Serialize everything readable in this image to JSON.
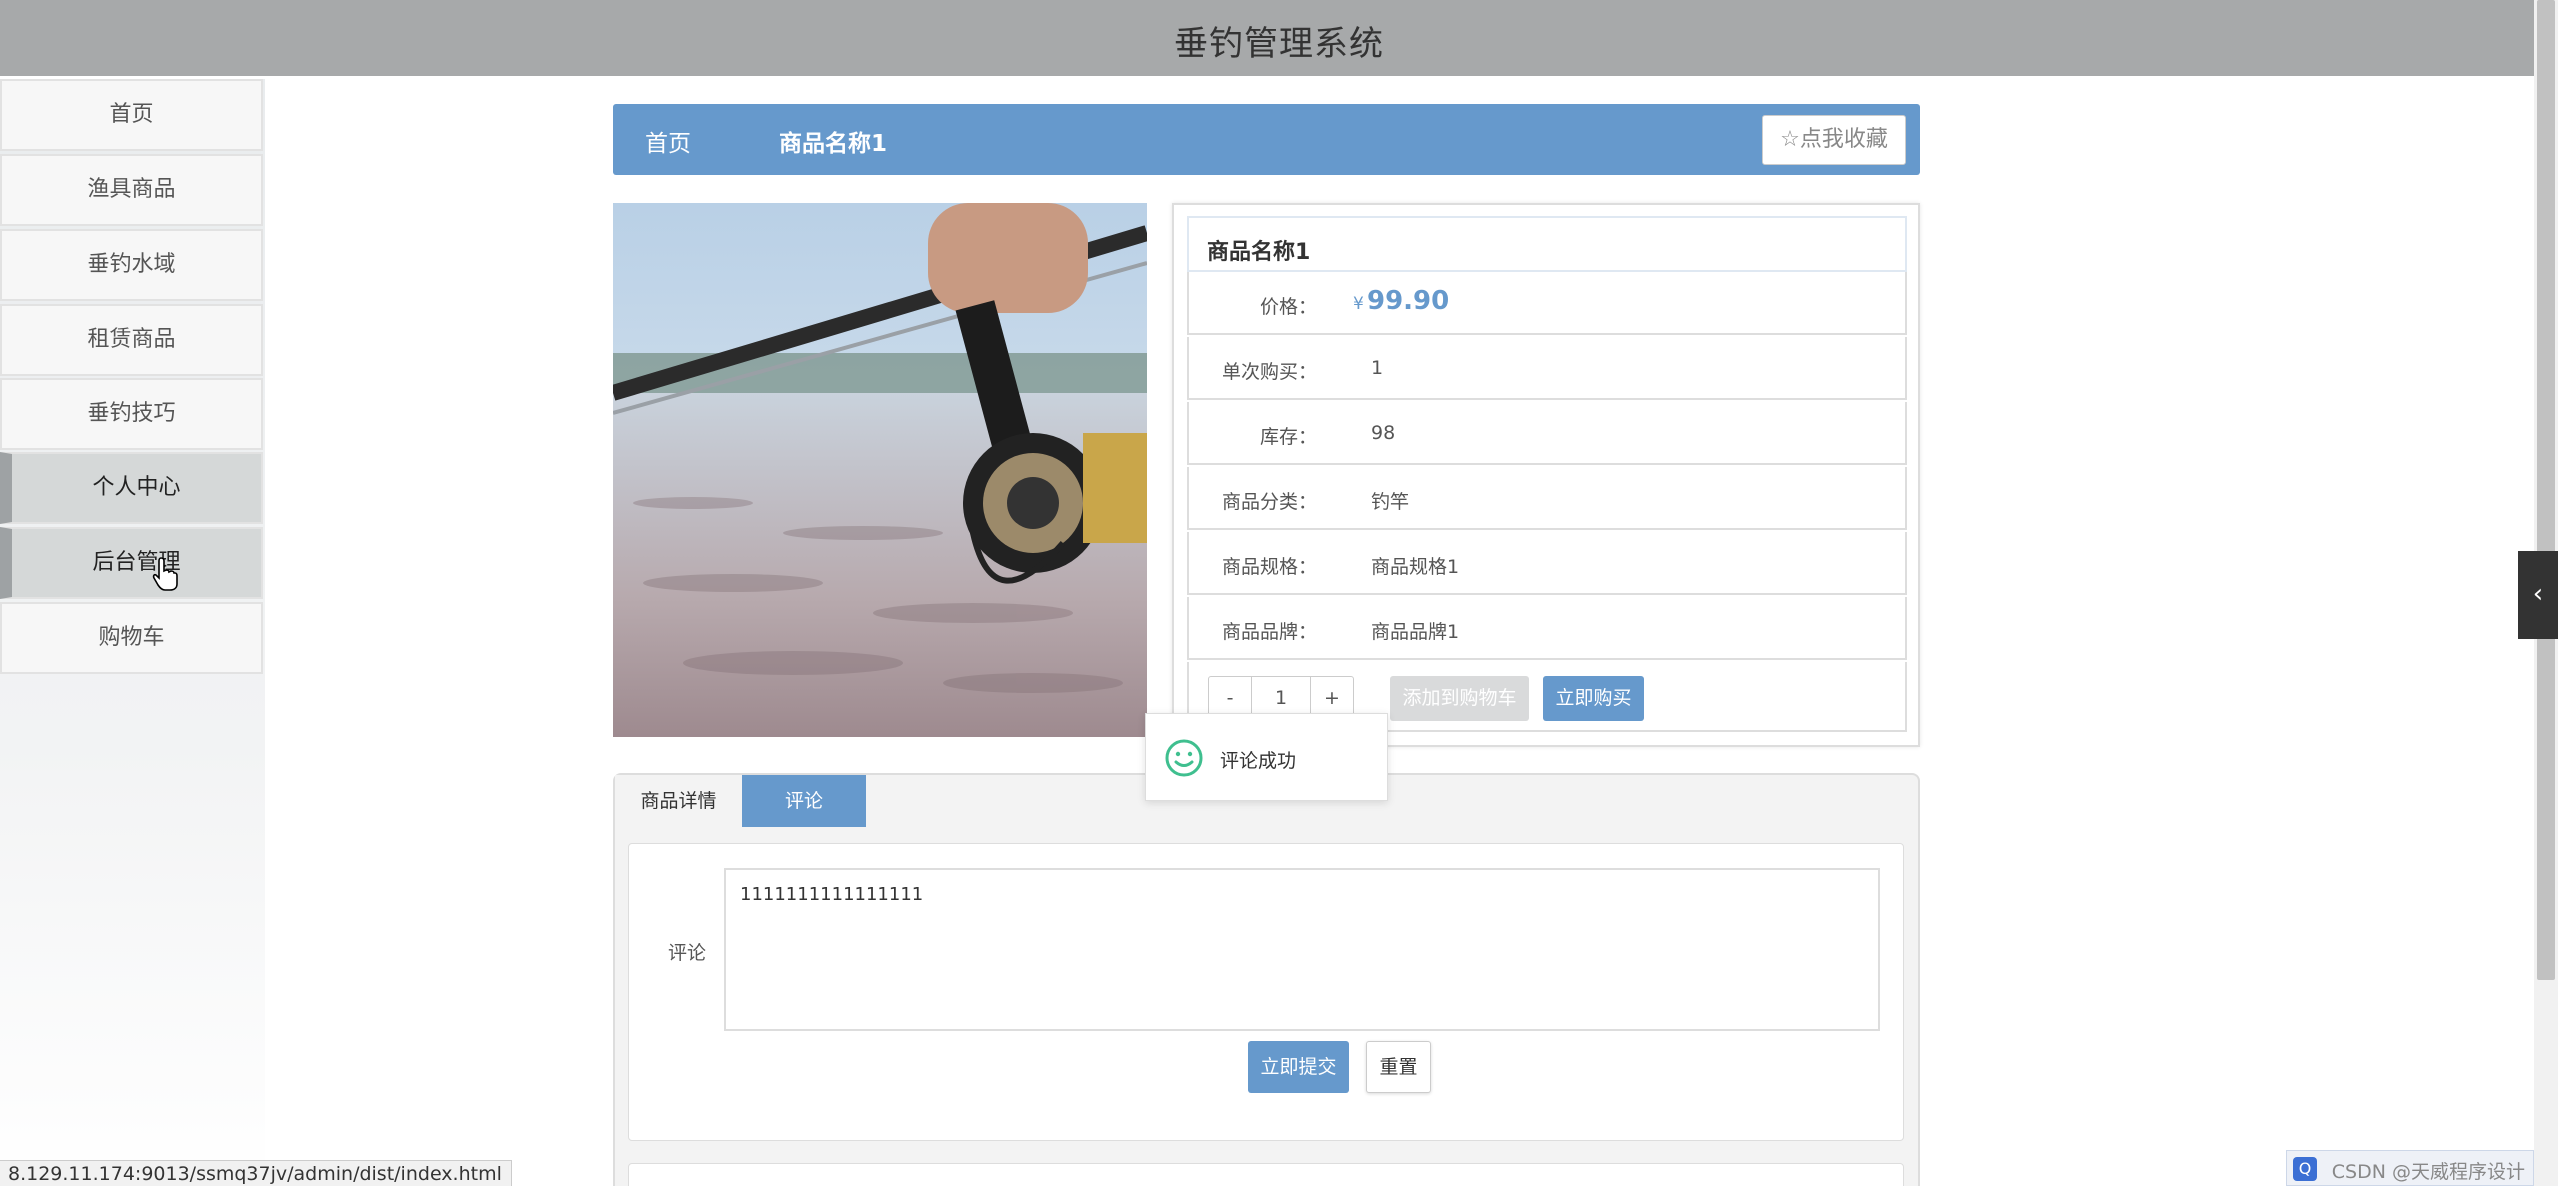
{
  "app": {
    "title": "垂钓管理系统"
  },
  "sidebar": {
    "items": [
      {
        "label": "首页"
      },
      {
        "label": "渔具商品"
      },
      {
        "label": "垂钓水域"
      },
      {
        "label": "租赁商品"
      },
      {
        "label": "垂钓技巧"
      },
      {
        "label": "个人中心"
      },
      {
        "label": "后台管理"
      },
      {
        "label": "购物车"
      }
    ]
  },
  "breadcrumb": {
    "home": "首页",
    "current": "商品名称1"
  },
  "favorite_label": "点我收藏",
  "product": {
    "name": "商品名称1",
    "price_label": "价格：",
    "price_symbol": "¥",
    "price": "99.90",
    "rows": [
      {
        "label": "单次购买：",
        "value": "1"
      },
      {
        "label": "库存：",
        "value": "98"
      },
      {
        "label": "商品分类：",
        "value": "钓竿"
      },
      {
        "label": "商品规格：",
        "value": "商品规格1"
      },
      {
        "label": "商品品牌：",
        "value": "商品品牌1"
      }
    ],
    "qty": {
      "minus": "-",
      "value": "1",
      "plus": "+"
    },
    "add_cart": "添加到购物车",
    "buy_now": "立即购买"
  },
  "toast": {
    "message": "评论成功"
  },
  "tabs": [
    {
      "label": "商品详情"
    },
    {
      "label": "评论"
    }
  ],
  "comment": {
    "label": "评论",
    "value": "1111111111111111",
    "submit": "立即提交",
    "reset": "重置"
  },
  "status_url": "8.129.11.174:9013/ssmq37jv/admin/dist/index.html",
  "watermark": "CSDN @天威程序设计",
  "colors": {
    "accent": "#6699cc",
    "header": "#a7a9aa"
  }
}
